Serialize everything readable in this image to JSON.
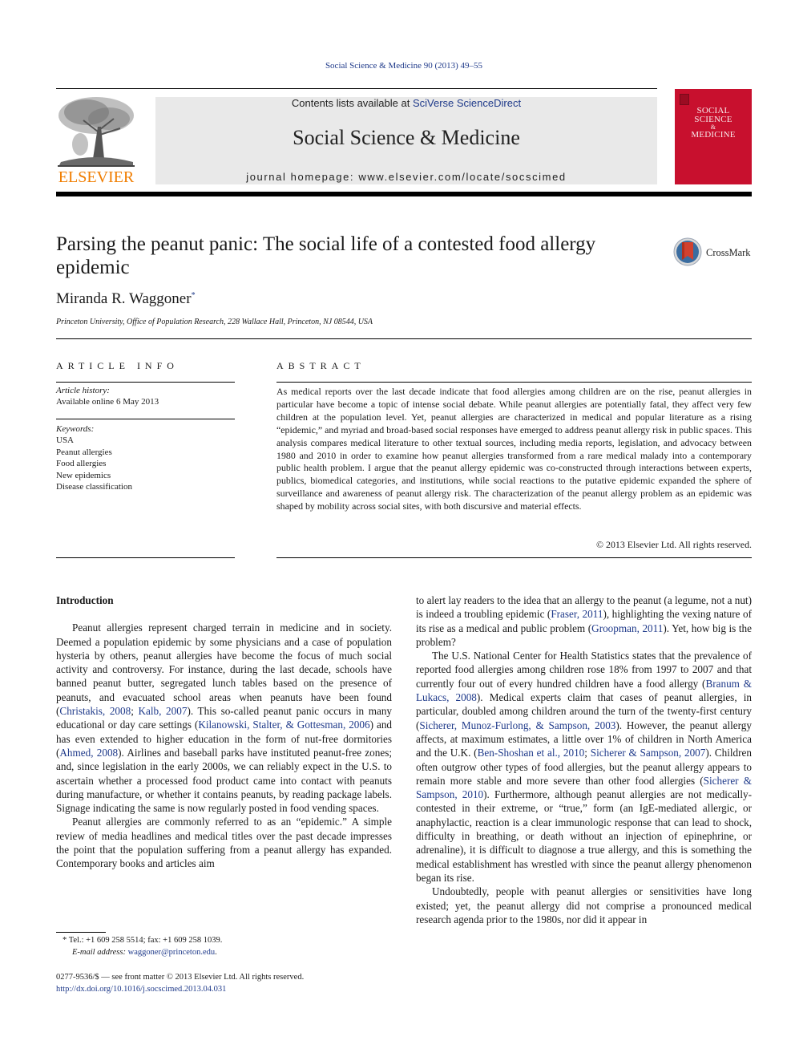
{
  "running_header": "Social Science & Medicine 90 (2013) 49–55",
  "publisher": {
    "name": "ELSEVIER",
    "logo_color": "#f07d00"
  },
  "banner": {
    "contents_prefix": "Contents lists available at ",
    "contents_link": "SciVerse ScienceDirect",
    "journal_name": "Social Science & Medicine",
    "homepage": "journal homepage: www.elsevier.com/locate/socscimed",
    "background": "#e9e9e9"
  },
  "cover": {
    "title_lines": [
      "SOCIAL",
      "SCIENCE",
      "&",
      "MEDICINE"
    ],
    "color": "#c8102e"
  },
  "article": {
    "title": "Parsing the peanut panic: The social life of a contested food allergy epidemic",
    "author": "Miranda R. Waggoner",
    "author_mark": "*",
    "affiliation": "Princeton University, Office of Population Research, 228 Wallace Hall, Princeton, NJ 08544, USA",
    "crossmark_label": "CrossMark"
  },
  "article_info": {
    "heading": "ARTICLE INFO",
    "history_label": "Article history:",
    "history_value": "Available online 6 May 2013",
    "keywords_label": "Keywords:",
    "keywords": [
      "USA",
      "Peanut allergies",
      "Food allergies",
      "New epidemics",
      "Disease classification"
    ]
  },
  "abstract": {
    "heading": "ABSTRACT",
    "text": "As medical reports over the last decade indicate that food allergies among children are on the rise, peanut allergies in particular have become a topic of intense social debate. While peanut allergies are potentially fatal, they affect very few children at the population level. Yet, peanut allergies are characterized in medical and popular literature as a rising “epidemic,” and myriad and broad-based social responses have emerged to address peanut allergy risk in public spaces. This analysis compares medical literature to other textual sources, including media reports, legislation, and advocacy between 1980 and 2010 in order to examine how peanut allergies transformed from a rare medical malady into a contemporary public health problem. I argue that the peanut allergy epidemic was co-constructed through interactions between experts, publics, biomedical categories, and institutions, while social reactions to the putative epidemic expanded the sphere of surveillance and awareness of peanut allergy risk. The characterization of the peanut allergy problem as an epidemic was shaped by mobility across social sites, with both discursive and material effects.",
    "copyright": "© 2013 Elsevier Ltd. All rights reserved."
  },
  "body": {
    "section_heading": "Introduction",
    "paragraphs": [
      {
        "indent": true,
        "segments": [
          {
            "t": "Peanut allergies represent charged terrain in medicine and in society. Deemed a population epidemic by some physicians and a case of population hysteria by others, peanut allergies have become the focus of much social activity and controversy. For instance, during the last decade, schools have banned peanut butter, segregated lunch tables based on the presence of peanuts, and evacuated school areas when peanuts have been found ("
          },
          {
            "t": "Christakis, 2008",
            "link": true
          },
          {
            "t": "; "
          },
          {
            "t": "Kalb, 2007",
            "link": true
          },
          {
            "t": "). This so-called peanut panic occurs in many educational or day care settings ("
          },
          {
            "t": "Kilanowski, Stalter, & Gottesman, 2006",
            "link": true
          },
          {
            "t": ") and has even extended to higher education in the form of nut-free dormitories ("
          },
          {
            "t": "Ahmed, 2008",
            "link": true
          },
          {
            "t": "). Airlines and baseball parks have instituted peanut-free zones; and, since legislation in the early 2000s, we can reliably expect in the U.S. to ascertain whether a processed food product came into contact with peanuts during manufacture, or whether it contains peanuts, by reading package labels. Signage indicating the same is now regularly posted in food vending spaces."
          }
        ]
      },
      {
        "indent": true,
        "segments": [
          {
            "t": "Peanut allergies are commonly referred to as an “epidemic.” A simple review of media headlines and medical titles over the past decade impresses the point that the population suffering from a peanut allergy has expanded. Contemporary books and articles aim"
          }
        ]
      },
      {
        "indent": false,
        "segments": [
          {
            "t": "to alert lay readers to the idea that an allergy to the peanut (a legume, not a nut) is indeed a troubling epidemic ("
          },
          {
            "t": "Fraser, 2011",
            "link": true
          },
          {
            "t": "), highlighting the vexing nature of its rise as a medical and public problem ("
          },
          {
            "t": "Groopman, 2011",
            "link": true
          },
          {
            "t": "). Yet, how big is the problem?"
          }
        ]
      },
      {
        "indent": true,
        "segments": [
          {
            "t": "The U.S. National Center for Health Statistics states that the prevalence of reported food allergies among children rose 18% from 1997 to 2007 and that currently four out of every hundred children have a food allergy ("
          },
          {
            "t": "Branum & Lukacs, 2008",
            "link": true
          },
          {
            "t": "). Medical experts claim that cases of peanut allergies, in particular, doubled among children around the turn of the twenty-first century ("
          },
          {
            "t": "Sicherer, Munoz-Furlong, & Sampson, 2003",
            "link": true
          },
          {
            "t": "). However, the peanut allergy affects, at maximum estimates, a little over 1% of children in North America and the U.K. ("
          },
          {
            "t": "Ben-Shoshan et al., 2010",
            "link": true
          },
          {
            "t": "; "
          },
          {
            "t": "Sicherer & Sampson, 2007",
            "link": true
          },
          {
            "t": "). Children often outgrow other types of food allergies, but the peanut allergy appears to remain more stable and more severe than other food allergies ("
          },
          {
            "t": "Sicherer & Sampson, 2010",
            "link": true
          },
          {
            "t": "). Furthermore, although peanut allergies are not medically-contested in their extreme, or “true,” form (an IgE-mediated allergic, or anaphylactic, reaction is a clear immunologic response that can lead to shock, difficulty in breathing, or death without an injection of epinephrine, or adrenaline), it is difficult to diagnose a true allergy, and this is something the medical establishment has wrestled with since the peanut allergy phenomenon began its rise."
          }
        ]
      },
      {
        "indent": true,
        "segments": [
          {
            "t": "Undoubtedly, people with peanut allergies or sensitivities have long existed; yet, the peanut allergy did not comprise a pronounced medical research agenda prior to the 1980s, nor did it appear in"
          }
        ]
      }
    ]
  },
  "footnote": {
    "mark": "*",
    "contact": "Tel.: +1 609 258 5514; fax: +1 609 258 1039.",
    "email_label": "E-mail address:",
    "email": "waggoner@princeton.edu",
    "email_suffix": "."
  },
  "front_matter": {
    "issn_line": "0277-9536/$ — see front matter © 2013 Elsevier Ltd. All rights reserved.",
    "doi": "http://dx.doi.org/10.1016/j.socscimed.2013.04.031"
  },
  "colors": {
    "link": "#1f3a8a",
    "text": "#1a1a1a"
  }
}
